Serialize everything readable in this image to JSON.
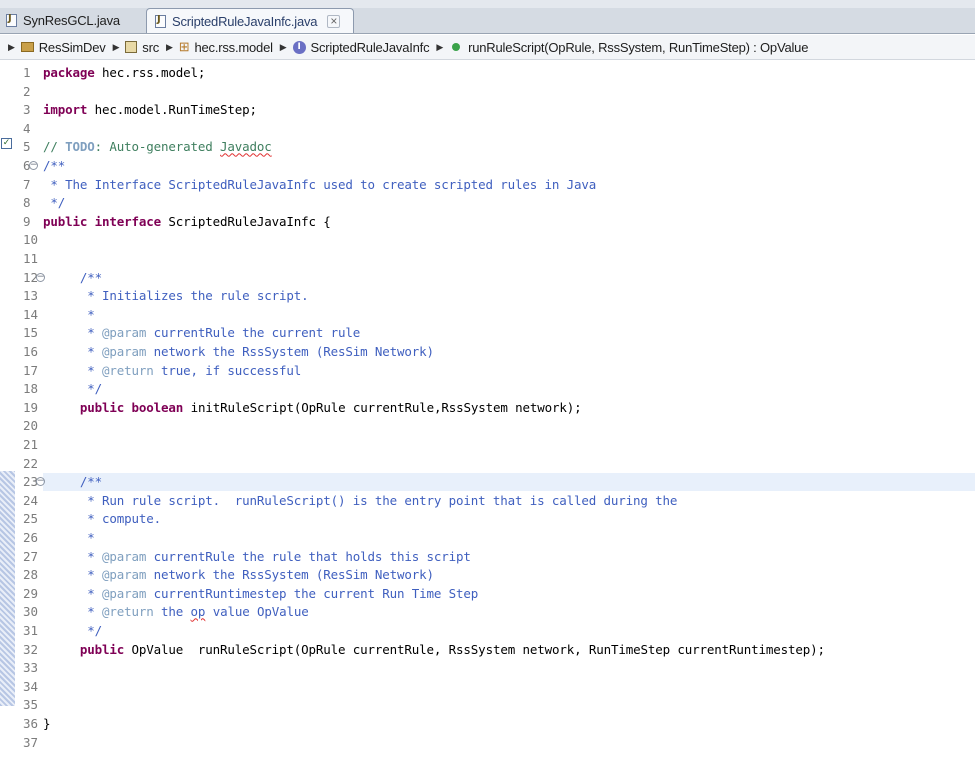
{
  "tabs": [
    {
      "label": "SynResGCL.java",
      "active": false,
      "icon": "java-file-icon"
    },
    {
      "label": "ScriptedRuleJavaInfc.java",
      "active": true,
      "icon": "java-file-icon",
      "close_icon": "close-icon"
    }
  ],
  "breadcrumb": [
    {
      "label": "ResSimDev",
      "icon": "project-icon"
    },
    {
      "label": "src",
      "icon": "source-folder-icon"
    },
    {
      "label": "hec.rss.model",
      "icon": "package-icon"
    },
    {
      "label": "ScriptedRuleJavaInfc",
      "icon": "interface-icon"
    },
    {
      "label": "runRuleScript(OpRule, RssSystem, RunTimeStep) : OpValue",
      "icon": "method-icon"
    }
  ],
  "editor": {
    "highlighted_line": 23,
    "folded_lines": [
      6,
      12,
      23
    ],
    "lines": [
      {
        "n": "1",
        "t": "package hec.rss.model;"
      },
      {
        "n": "2",
        "t": ""
      },
      {
        "n": "3",
        "t": "import hec.model.RunTimeStep;"
      },
      {
        "n": "4",
        "t": ""
      },
      {
        "n": "5",
        "t": "// TODO: Auto-generated Javadoc"
      },
      {
        "n": "6",
        "t": "/**"
      },
      {
        "n": "7",
        "t": " * The Interface ScriptedRuleJavaInfc used to create scripted rules in Java"
      },
      {
        "n": "8",
        "t": " */"
      },
      {
        "n": "9",
        "t": "public interface ScriptedRuleJavaInfc {"
      },
      {
        "n": "10",
        "t": ""
      },
      {
        "n": "11",
        "t": ""
      },
      {
        "n": "12",
        "t": "     /**"
      },
      {
        "n": "13",
        "t": "      * Initializes the rule script."
      },
      {
        "n": "14",
        "t": "      *"
      },
      {
        "n": "15",
        "t": "      * @param currentRule the current rule"
      },
      {
        "n": "16",
        "t": "      * @param network the RssSystem (ResSim Network)"
      },
      {
        "n": "17",
        "t": "      * @return true, if successful"
      },
      {
        "n": "18",
        "t": "      */"
      },
      {
        "n": "19",
        "t": "     public boolean initRuleScript(OpRule currentRule,RssSystem network);"
      },
      {
        "n": "20",
        "t": ""
      },
      {
        "n": "21",
        "t": ""
      },
      {
        "n": "22",
        "t": ""
      },
      {
        "n": "23",
        "t": "     /**"
      },
      {
        "n": "24",
        "t": "      * Run rule script.  runRuleScript() is the entry point that is called during the"
      },
      {
        "n": "25",
        "t": "      * compute."
      },
      {
        "n": "26",
        "t": "      *"
      },
      {
        "n": "27",
        "t": "      * @param currentRule the rule that holds this script"
      },
      {
        "n": "28",
        "t": "      * @param network the RssSystem (ResSim Network)"
      },
      {
        "n": "29",
        "t": "      * @param currentRuntimestep the current Run Time Step"
      },
      {
        "n": "30",
        "t": "      * @return the op value OpValue"
      },
      {
        "n": "31",
        "t": "      */"
      },
      {
        "n": "32",
        "t": "     public OpValue  runRuleScript(OpRule currentRule, RssSystem network, RunTimeStep currentRuntimestep);"
      },
      {
        "n": "33",
        "t": ""
      },
      {
        "n": "34",
        "t": ""
      },
      {
        "n": "35",
        "t": ""
      },
      {
        "n": "36",
        "t": "}"
      },
      {
        "n": "37",
        "t": ""
      }
    ]
  },
  "colors": {
    "keyword": "#7f0055",
    "javadoc": "#3f5fbf",
    "line_comment": "#3f7f5f",
    "javadoc_tag": "#7f9fbf",
    "current_line": "#e8f0fb"
  }
}
